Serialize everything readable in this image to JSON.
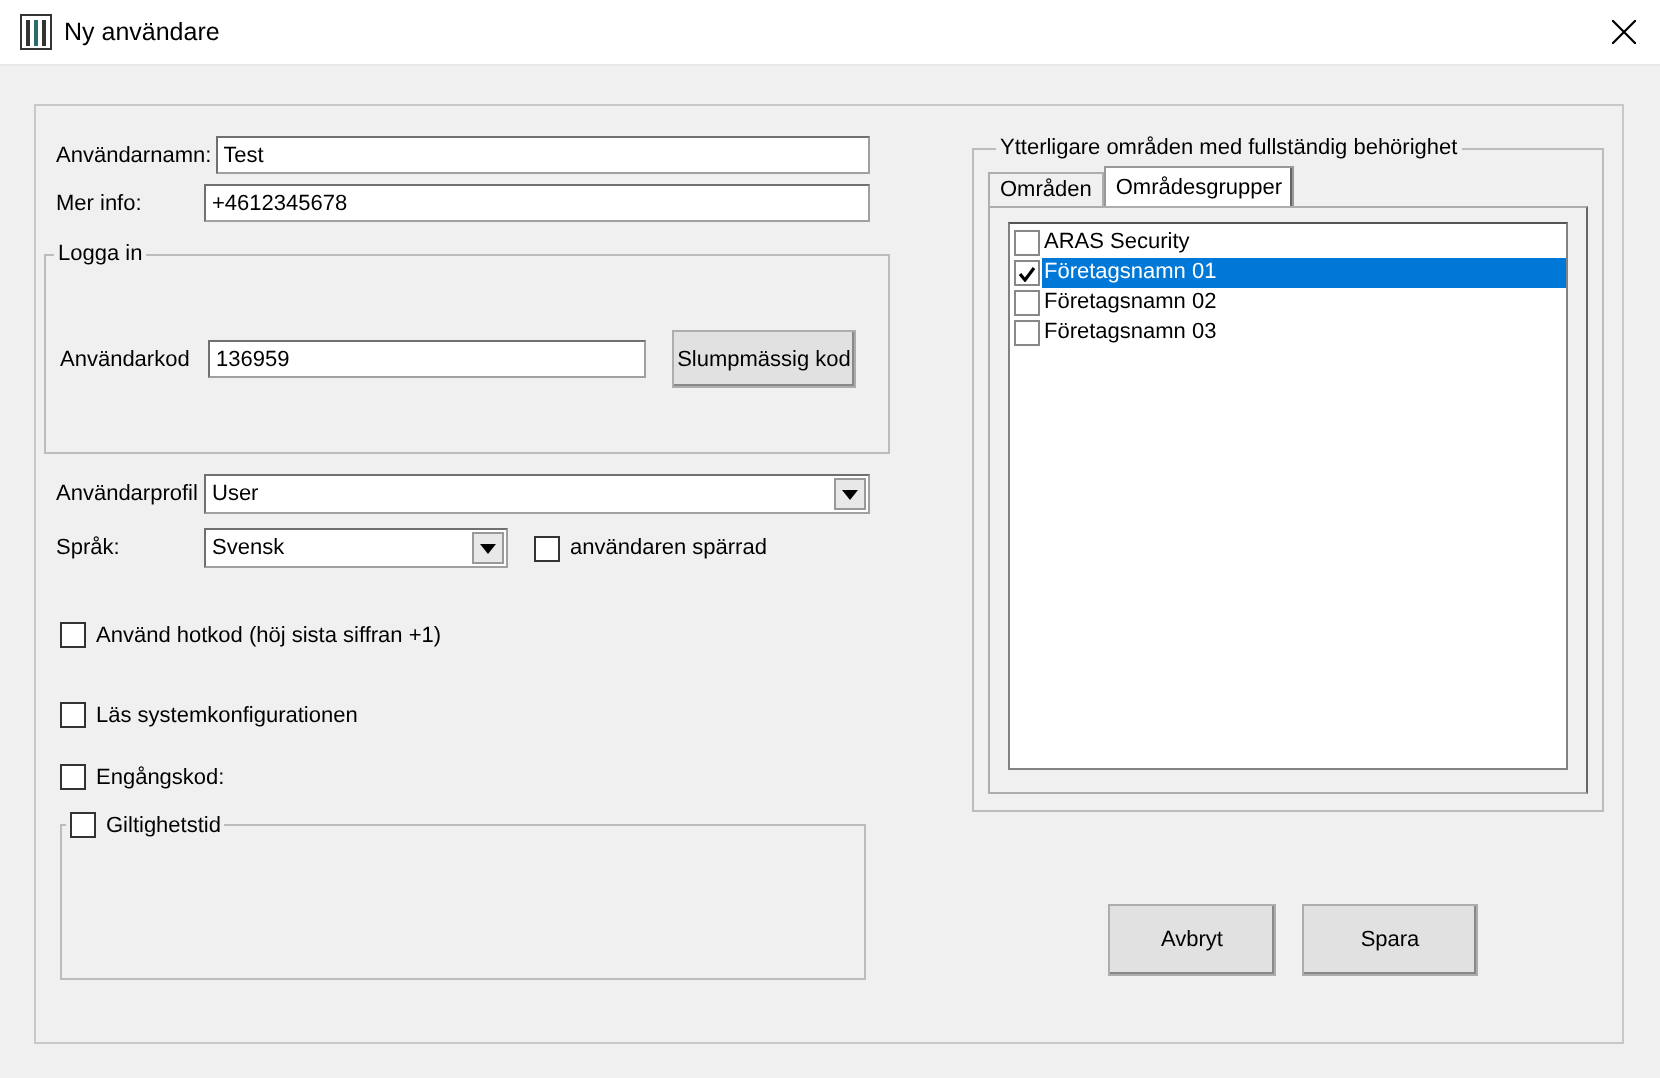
{
  "window": {
    "title": "Ny användare"
  },
  "fields": [
    {
      "label": "Användarnamn:",
      "value": "Test"
    },
    {
      "label": "Mer info:",
      "value": "+4612345678"
    }
  ],
  "login": {
    "legend": "Logga in",
    "code_label": "Användarkod",
    "code_value": "136959",
    "button": "Slumpmässig kod"
  },
  "profile": {
    "label": "Användarprofil",
    "value": "User"
  },
  "language": {
    "label": "Språk:",
    "value": "Svensk"
  },
  "blocked": {
    "label": "användaren spärrad",
    "checked": false
  },
  "options": [
    {
      "label": "Använd hotkod (höj sista siffran +1)",
      "checked": false
    },
    {
      "label": "Läs systemkonfigurationen",
      "checked": false
    },
    {
      "label": "Engångskod:",
      "checked": false
    }
  ],
  "validity": {
    "label": "Giltighetstid",
    "checked": false
  },
  "areas": {
    "legend": "Ytterligare områden med fullständig behörighet",
    "tabs": [
      {
        "label": "Områden",
        "selected": false
      },
      {
        "label": "Områdesgrupper",
        "selected": true
      }
    ],
    "items": [
      {
        "label": "ARAS Security",
        "checked": false,
        "selected": false
      },
      {
        "label": "Företagsnamn 01",
        "checked": true,
        "selected": true
      },
      {
        "label": "Företagsnamn 02",
        "checked": false,
        "selected": false
      },
      {
        "label": "Företagsnamn 03",
        "checked": false,
        "selected": false
      }
    ]
  },
  "buttons": [
    "Avbryt",
    "Spara"
  ]
}
